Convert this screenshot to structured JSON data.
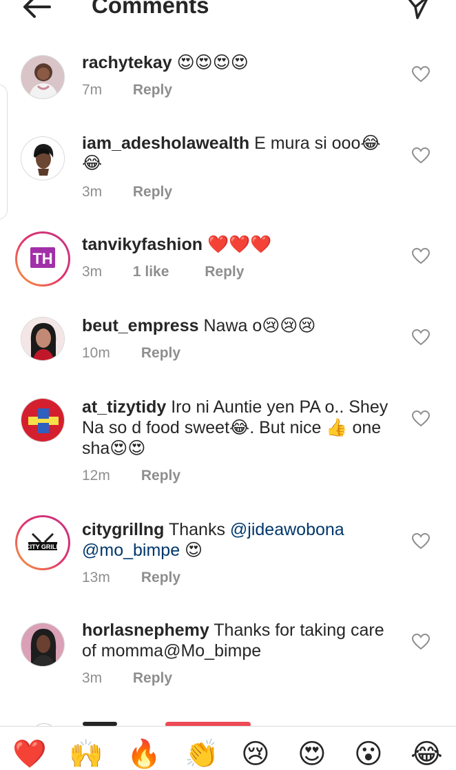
{
  "header": {
    "title": "Comments",
    "back_icon": "arrow-left-icon",
    "send_icon": "paper-plane-icon"
  },
  "comments": [
    {
      "username": "rachytekay",
      "text": "😍😍😍😍",
      "time": "7m",
      "likes": "",
      "reply": "Reply"
    },
    {
      "username": "iam_adesholawealth",
      "text": "E mura si ooo😂😂",
      "time": "3m",
      "likes": "",
      "reply": "Reply"
    },
    {
      "username": "tanvikyfashion",
      "text": "❤️❤️❤️",
      "time": "3m",
      "likes": "1 like",
      "reply": "Reply"
    },
    {
      "username": "beut_empress",
      "text": "Nawa o😢😢😢",
      "time": "10m",
      "likes": "",
      "reply": "Reply"
    },
    {
      "username": "at_tizytidy",
      "text": "Iro ni Auntie yen PA o.. Shey Na so d food sweet😂. But nice 👍 one sha😍😍",
      "time": "12m",
      "likes": "",
      "reply": "Reply"
    },
    {
      "username": "citygrillng",
      "text_before": "Thanks ",
      "mention1": "@jideawobona",
      "mention2": "@mo_bimpe",
      "text_after": " 😍",
      "time": "13m",
      "likes": "",
      "reply": "Reply"
    },
    {
      "username": "horlasnephemy",
      "text": "Thanks for taking care of momma@Mo_bimpe",
      "time": "3m",
      "likes": "",
      "reply": "Reply"
    }
  ],
  "emoji_bar": [
    "❤️",
    "🙌",
    "🔥",
    "👏",
    "😢",
    "😍",
    "😮",
    "😂"
  ],
  "colors": {
    "text": "#262626",
    "meta": "#8e8e8e",
    "mention": "#00376b",
    "heart_red": "#ed4956"
  }
}
